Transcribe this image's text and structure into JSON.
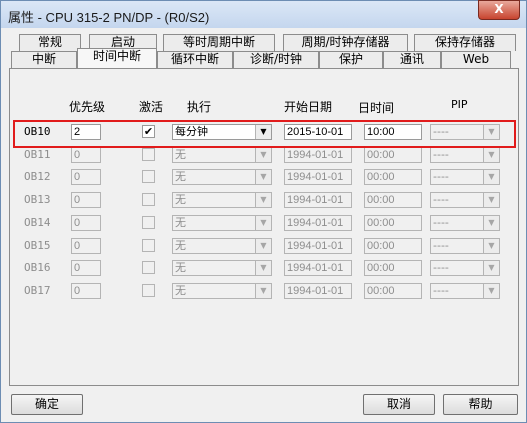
{
  "window": {
    "title": "属性 - CPU 315-2 PN/DP - (R0/S2)",
    "close_label": "X"
  },
  "tabs_row1": [
    "常规",
    "启动",
    "等时周期中断",
    "周期/时钟存储器",
    "保持存储器"
  ],
  "tabs_row2": [
    "中断",
    "时间中断",
    "循环中断",
    "诊断/时钟",
    "保护",
    "通讯",
    "Web"
  ],
  "active_tab": "时间中断",
  "headers": {
    "priority": "优先级",
    "active": "激活",
    "execute": "执行",
    "start_date": "开始日期",
    "time": "日时间",
    "pip": "PIP"
  },
  "rows": [
    {
      "ob": "OB10",
      "ob_underline": "1",
      "priority": "2",
      "active": true,
      "execute": "每分钟",
      "date": "2015-10-01",
      "time": "10:00",
      "pip": "----",
      "enabled": true
    },
    {
      "ob": "OB11",
      "priority": "0",
      "active": false,
      "execute": "无",
      "date": "1994-01-01",
      "time": "00:00",
      "pip": "----",
      "enabled": false
    },
    {
      "ob": "OB12",
      "priority": "0",
      "active": false,
      "execute": "无",
      "date": "1994-01-01",
      "time": "00:00",
      "pip": "----",
      "enabled": false
    },
    {
      "ob": "OB13",
      "priority": "0",
      "active": false,
      "execute": "无",
      "date": "1994-01-01",
      "time": "00:00",
      "pip": "----",
      "enabled": false
    },
    {
      "ob": "OB14",
      "priority": "0",
      "active": false,
      "execute": "无",
      "date": "1994-01-01",
      "time": "00:00",
      "pip": "----",
      "enabled": false
    },
    {
      "ob": "OB15",
      "priority": "0",
      "active": false,
      "execute": "无",
      "date": "1994-01-01",
      "time": "00:00",
      "pip": "----",
      "enabled": false
    },
    {
      "ob": "OB16",
      "priority": "0",
      "active": false,
      "execute": "无",
      "date": "1994-01-01",
      "time": "00:00",
      "pip": "----",
      "enabled": false
    },
    {
      "ob": "OB17",
      "priority": "0",
      "active": false,
      "execute": "无",
      "date": "1994-01-01",
      "time": "00:00",
      "pip": "----",
      "enabled": false
    }
  ],
  "buttons": {
    "ok": "确定",
    "cancel": "取消",
    "help": "帮助"
  },
  "colors": {
    "highlight": "#e11b1b",
    "disabled_text": "#8e8e8e"
  }
}
